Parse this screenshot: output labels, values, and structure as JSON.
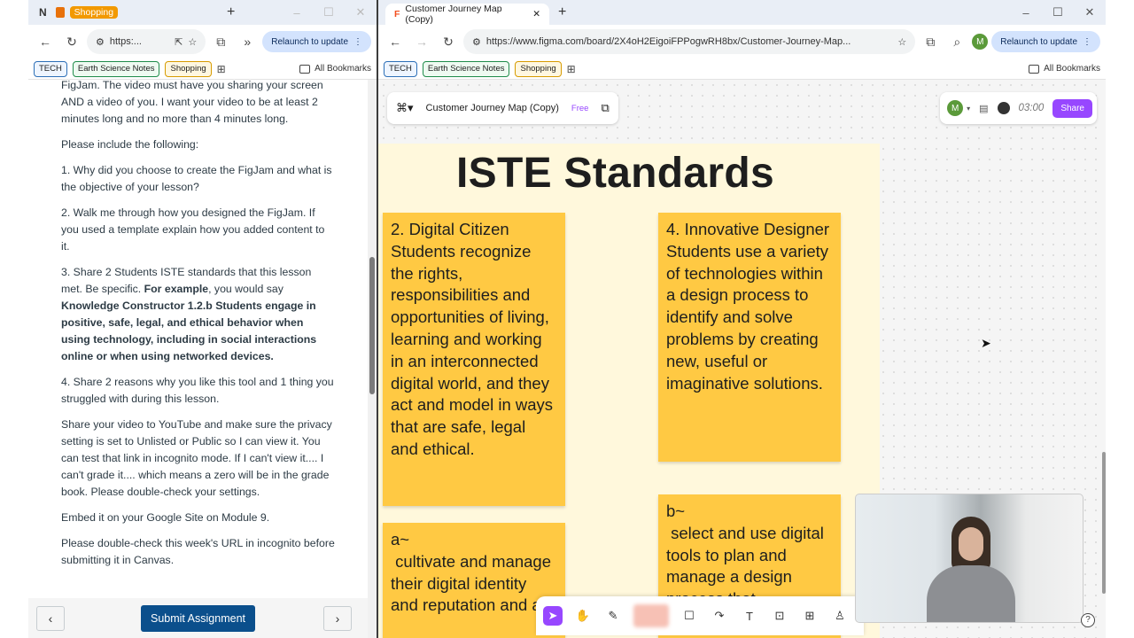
{
  "left_browser": {
    "tab_label": "Shopping",
    "url": "https:...",
    "relaunch_label": "Relaunch to update",
    "bookmarks": [
      "TECH",
      "Earth Science Notes",
      "Shopping"
    ],
    "all_bookmarks": "All Bookmarks"
  },
  "assignment": {
    "p1": "FigJam.  The video must have you sharing your screen AND a video of you.  I want your video to be at least 2 minutes long and no more than 4 minutes long.",
    "p2": "Please include the following:",
    "p3": "1.  Why did you choose to create the FigJam and what is the objective of your lesson?",
    "p4": "2.  Walk me through how you designed the FigJam.  If you used a template explain how you added content to it.",
    "p5_prefix": "3.  Share 2 Students ISTE standards that this lesson met.  Be specific. ",
    "p5_bold": "For example",
    "p5_mid": ", you would say ",
    "p5_example": "Knowledge Constructor 1.2.b Students engage in positive, safe, legal, and ethical behavior when using technology, including in social interactions online or when using networked devices.",
    "p6": "4.  Share 2 reasons why you like this tool and 1 thing you struggled with during this lesson.",
    "p7": "Share your video to YouTube and make sure the privacy setting is set to Unlisted or Public so I can view it.  You can test that link in incognito mode.  If I can't view it.... I can't grade it.... which means a zero will be in the grade book. Please double-check your settings.",
    "p8": "Embed it on your Google Site on Module 9.",
    "p9": "Please double-check this week's URL in incognito before submitting it in Canvas.",
    "submit_label": "Submit Assignment"
  },
  "right_browser": {
    "tab_label": "Customer Journey Map (Copy)",
    "url": "https://www.figma.com/board/2X4oH2EigoiFPPogwRH8bx/Customer-Journey-Map...",
    "relaunch_label": "Relaunch to update",
    "bookmarks": [
      "TECH",
      "Earth Science Notes",
      "Shopping"
    ],
    "all_bookmarks": "All Bookmarks",
    "profile_initial": "M"
  },
  "figjam": {
    "file_name": "Customer Journey Map (Copy)",
    "plan_badge": "Free",
    "avatar_initial": "M",
    "timer": "03:00",
    "share_label": "Share",
    "section_title": "ISTE Standards",
    "stickies": [
      "2. Digital Citizen\nStudents recognize the rights, responsibilities and opportunities of living, learning and working in an interconnected digital world, and they act and model in ways that are safe, legal and ethical.",
      "4. Innovative Designer\nStudents use a variety of technologies within a design process to identify and solve problems by creating new, useful or imaginative solutions.",
      "a~\n cultivate and manage their digital identity and reputation and are",
      "b~\n select and use digital tools to plan and manage a design process that"
    ],
    "colors": {
      "sticky": "#ffc943",
      "section": "#fff8dc",
      "accent": "#9747ff"
    }
  }
}
